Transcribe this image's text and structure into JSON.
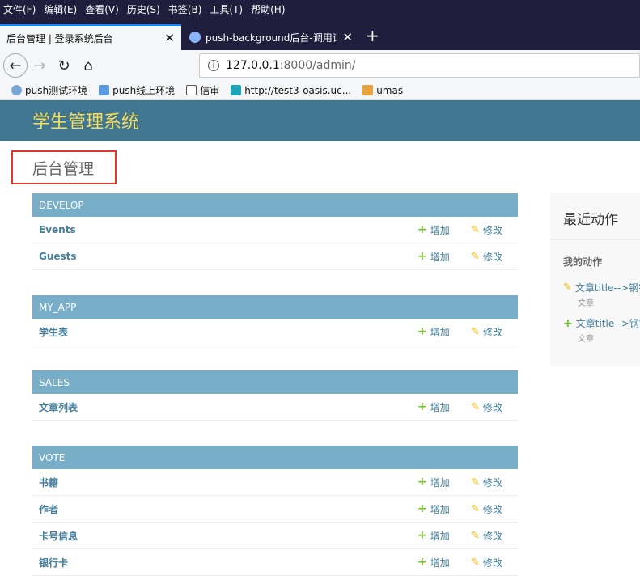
{
  "browser": {
    "menu": [
      "文件(F)",
      "编辑(E)",
      "查看(V)",
      "历史(S)",
      "书签(B)",
      "工具(T)",
      "帮助(H)"
    ],
    "tabs": [
      {
        "label": "后台管理 | 登录系统后台",
        "close": "✕"
      },
      {
        "label": "push-background后台-调用记",
        "close": "✕"
      }
    ],
    "new_tab": "+",
    "url_host": "127.0.0.1",
    "url_path": ":8000/admin/",
    "bookmarks": [
      "push测试环境",
      "push线上环境",
      "信审",
      "http://test3-oasis.uc...",
      "umas"
    ]
  },
  "site": {
    "header": "学生管理系统",
    "page_title": "后台管理"
  },
  "modules": [
    {
      "caption": "DEVELOP",
      "rows": [
        "Events",
        "Guests"
      ]
    },
    {
      "caption": "MY_APP",
      "rows": [
        "学生表"
      ]
    },
    {
      "caption": "SALES",
      "rows": [
        "文章列表"
      ]
    },
    {
      "caption": "VOTE",
      "rows": [
        "书籍",
        "作者",
        "卡号信息",
        "银行卡"
      ]
    }
  ],
  "actions": {
    "add": "增加",
    "change": "修改"
  },
  "recent": {
    "title": "最近动作",
    "subtitle": "我的动作",
    "entries": [
      {
        "icon": "pencil",
        "text": "文章title-->钢铁",
        "type": "文章"
      },
      {
        "icon": "plus",
        "text": "文章title-->钢铁",
        "type": "文章"
      }
    ]
  },
  "colors": {
    "header_bg": "#417690",
    "header_text": "#f5dd5d",
    "caption_bg": "#79aec8",
    "link": "#447e9b",
    "add_green": "#70bf2b",
    "change_yellow": "#efb80b",
    "highlight_box": "#e0362b"
  }
}
